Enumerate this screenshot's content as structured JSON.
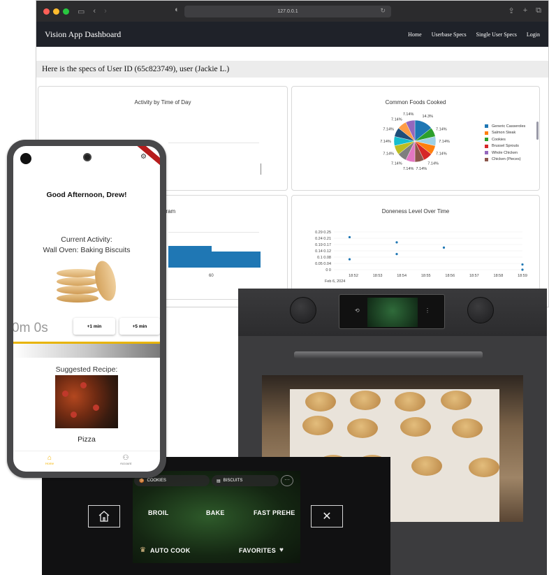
{
  "browser": {
    "url": "127.0.0.1",
    "brand": "Vision App Dashboard",
    "nav": [
      "Home",
      "Userbase Specs",
      "Single User Specs",
      "Login"
    ],
    "specs_title": "Here is the specs of User ID (65c823749), user (Jackie L.)"
  },
  "charts": {
    "activity_title": "Activity by Time of Day",
    "histogram_title": "Histogram",
    "histogram_tick": "60",
    "foods_title": "Common Foods Cooked",
    "doneness_title": "Doneness Level Over Time",
    "doneness_date": "Feb 6, 2024"
  },
  "chart_data": [
    {
      "type": "pie",
      "title": "Common Foods Cooked",
      "legend": [
        "Generic Casseroles",
        "Salmon Steak",
        "Cookies",
        "Brussel Sprouts",
        "Whole Chicken",
        "Chicken (Pieces)"
      ],
      "labels": [
        "14.3%",
        "7.14%",
        "7.14%",
        "7.14%",
        "7.14%",
        "7.14%",
        "7.14%",
        "7.14%",
        "7.14%",
        "7.14%",
        "7.14%",
        "7.14%",
        "7.14%"
      ],
      "values": [
        14.3,
        7.14,
        7.14,
        7.14,
        7.14,
        7.14,
        7.14,
        7.14,
        7.14,
        7.14,
        7.14,
        7.14,
        7.14
      ],
      "colors": [
        "#1f77b4",
        "#2ca02c",
        "#9ed1e5",
        "#ff7f0e",
        "#d62728",
        "#8c564b",
        "#e377c2",
        "#7f7f7f",
        "#bcbd22",
        "#17becf",
        "#1f4e79",
        "#ff9d45",
        "#9467bd"
      ],
      "legend_colors": [
        "#1f77b4",
        "#ff7f0e",
        "#2ca02c",
        "#d62728",
        "#9467bd",
        "#8c564b"
      ]
    },
    {
      "type": "scatter",
      "title": "Doneness Level Over Time",
      "xticks": [
        "18:52",
        "18:53",
        "18:54",
        "18:55",
        "18:56",
        "18:57",
        "18:58",
        "18:59"
      ],
      "yticks": [
        "0.29 0.25",
        "0.24 0.21",
        "0.19 0.17",
        "0.14 0.12",
        "0.1 0.08",
        "0.05 0.04",
        "0 0"
      ],
      "points": [
        {
          "x": 18.87,
          "y": 0.25
        },
        {
          "x": 18.9,
          "y": 0.21
        },
        {
          "x": 18.9,
          "y": 0.12
        },
        {
          "x": 18.93,
          "y": 0.17
        },
        {
          "x": 18.87,
          "y": 0.08
        },
        {
          "x": 18.98,
          "y": 0.04
        },
        {
          "x": 18.98,
          "y": 0.0
        }
      ],
      "xrange": [
        18.86,
        18.98
      ],
      "yrange": [
        0,
        0.29
      ],
      "color": "#1f77b4"
    },
    {
      "type": "bar",
      "title": "Histogram",
      "values": [
        1,
        0.75
      ],
      "color": "#1f77b4"
    }
  ],
  "phone": {
    "greeting": "Good Afternoon, Drew!",
    "activity_label": "Current Activity:",
    "activity_value": "Wall Oven: Baking Biscuits",
    "timer": "0m 0s",
    "btn_plus1": "+1 min",
    "btn_plus5": "+5 min",
    "recipe_label": "Suggested Recipe:",
    "recipe_name": "Pizza",
    "tab_home": "Home",
    "tab_account": "Account",
    "accent": "#f5b400"
  },
  "panel": {
    "chip_cookies": "COOKIES",
    "chip_biscuits": "BISCUITS",
    "broil": "BROIL",
    "bake": "BAKE",
    "fast_preheat": "FAST PREHE",
    "auto_cook": "AUTO COOK",
    "favorites": "FAVORITES"
  }
}
